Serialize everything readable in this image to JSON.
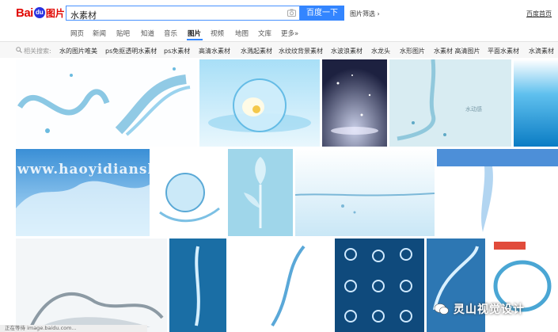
{
  "header": {
    "logo": {
      "bai": "Bai",
      "du": "du",
      "pic": "图片"
    },
    "search_query": "水素材",
    "search_button": "百度一下",
    "filter_label": "图片筛选",
    "home_link": "百度首页"
  },
  "tabs": [
    {
      "label": "网页",
      "active": false
    },
    {
      "label": "新闻",
      "active": false
    },
    {
      "label": "贴吧",
      "active": false
    },
    {
      "label": "知道",
      "active": false
    },
    {
      "label": "音乐",
      "active": false
    },
    {
      "label": "图片",
      "active": true
    },
    {
      "label": "视频",
      "active": false
    },
    {
      "label": "地图",
      "active": false
    },
    {
      "label": "文库",
      "active": false
    },
    {
      "label": "更多»",
      "active": false
    }
  ],
  "related": {
    "label": "相关搜索:",
    "items": [
      "水的图片唯美",
      "ps免抠透明水素材",
      "ps水素材",
      "高清水素材",
      "水溅起素材",
      "水纹纹背景素材",
      "水波浪素材",
      "水龙头",
      "水形图片",
      "水素材 高清图片",
      "平面水素材",
      "水滴素材"
    ]
  },
  "thumbnails": [
    {
      "desc": "water splash"
    },
    {
      "desc": "flower in water bubble"
    },
    {
      "desc": "dark background water drops"
    },
    {
      "desc": "water pour"
    },
    {
      "desc": "blue water wave"
    },
    {
      "desc": "water wave splash"
    },
    {
      "desc": "water sphere"
    },
    {
      "desc": "water flower"
    },
    {
      "desc": "water surface"
    },
    {
      "desc": "water drop down"
    },
    {
      "desc": "water crown splash"
    },
    {
      "desc": "vertical water splash"
    },
    {
      "desc": "water stream"
    },
    {
      "desc": "water splash set"
    },
    {
      "desc": "water curve"
    },
    {
      "desc": "water ring"
    }
  ],
  "thumb_overlay": {
    "watermark": "www.haoyidiansh",
    "thumb_text": "水动感"
  },
  "brand_overlay": "灵山视觉设计",
  "status_text": "正在等待 image.baidu.com..."
}
